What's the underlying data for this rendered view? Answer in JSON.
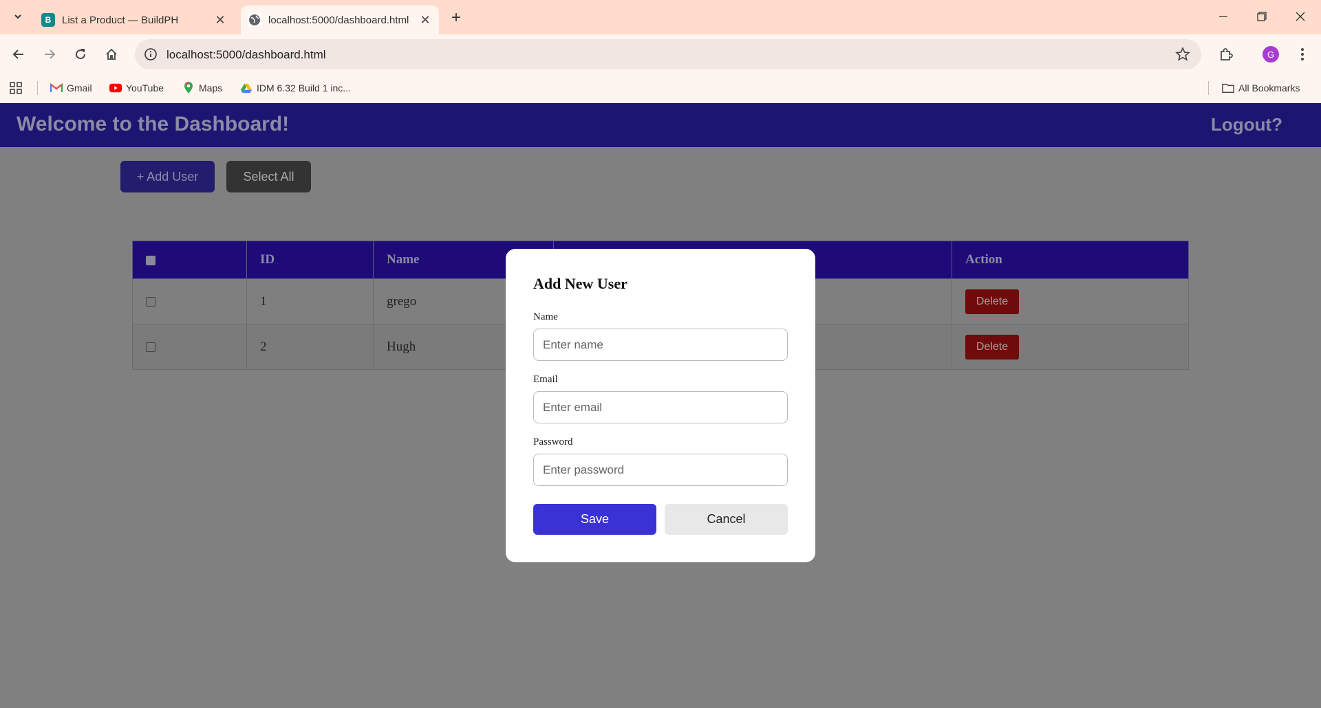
{
  "browser": {
    "tabs": [
      {
        "title": "List a Product — BuildPH",
        "favicon": "B",
        "active": false
      },
      {
        "title": "localhost:5000/dashboard.html",
        "favicon": "globe-icon",
        "active": true
      }
    ],
    "url": "localhost:5000/dashboard.html",
    "profile_initial": "G",
    "bookmarks": [
      {
        "label": "Gmail",
        "icon": "gmail-icon"
      },
      {
        "label": "YouTube",
        "icon": "youtube-icon"
      },
      {
        "label": "Maps",
        "icon": "maps-icon"
      },
      {
        "label": "IDM 6.32 Build 1 inc...",
        "icon": "drive-icon"
      }
    ],
    "all_bookmarks": "All Bookmarks"
  },
  "header": {
    "title": "Welcome to the Dashboard!",
    "logout": "Logout?"
  },
  "toolbar": {
    "add_user": "+ Add User",
    "select_all": "Select All"
  },
  "table": {
    "columns": [
      "",
      "ID",
      "Name",
      "",
      "Action"
    ],
    "rows": [
      {
        "id": "1",
        "name": "grego",
        "action": "Delete"
      },
      {
        "id": "2",
        "name": "Hugh",
        "action": "Delete"
      }
    ]
  },
  "modal": {
    "title": "Add New User",
    "name_label": "Name",
    "name_placeholder": "Enter name",
    "email_label": "Email",
    "email_placeholder": "Enter email",
    "password_label": "Password",
    "password_placeholder": "Enter password",
    "save": "Save",
    "cancel": "Cancel"
  },
  "colors": {
    "app_bar": "#1c1571",
    "table_header": "#1e0b78",
    "save_button": "#3a32d4",
    "delete_button": "#6f0b0b",
    "overlay": "#808080"
  }
}
